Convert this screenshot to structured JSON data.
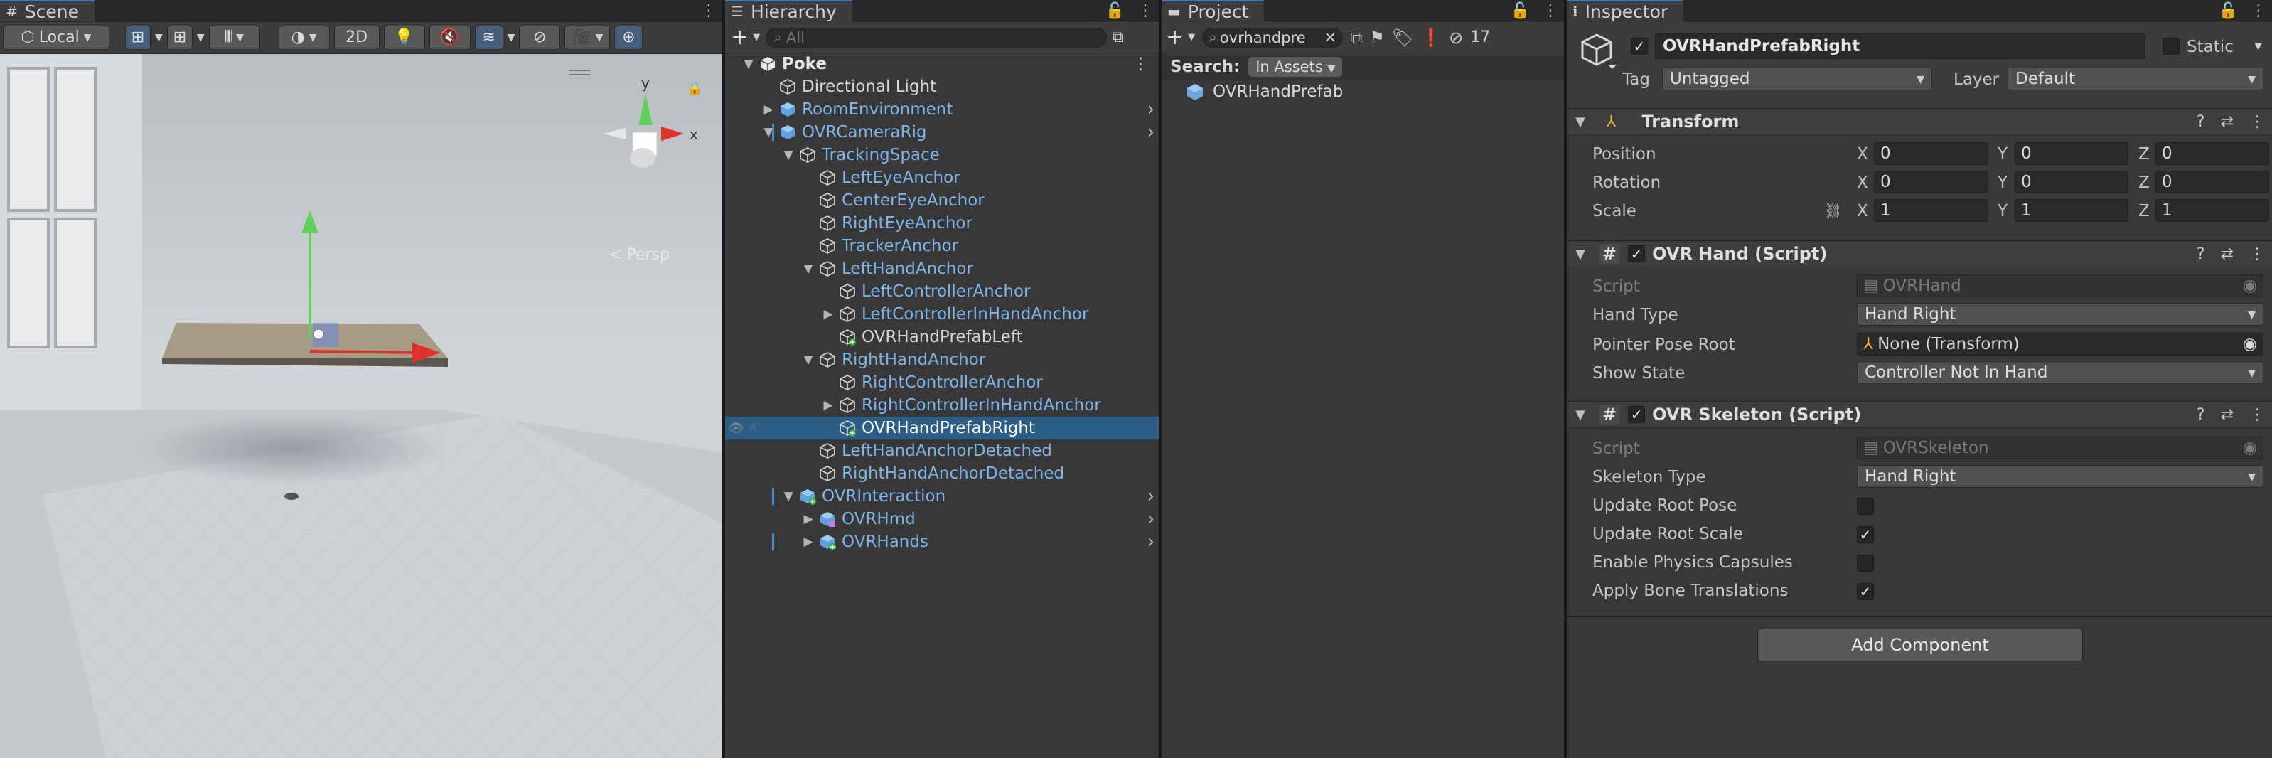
{
  "scene": {
    "tab": "Scene",
    "toolbar": {
      "pivot": "Local",
      "mode_2d": "2D"
    },
    "persp_label": "< Persp",
    "gizmo_axes": {
      "x": "x",
      "y": "y"
    }
  },
  "hierarchy": {
    "tab": "Hierarchy",
    "search_placeholder": "All",
    "items": [
      {
        "label": "Poke",
        "depth": 0,
        "expanded": true,
        "bold": true,
        "icon": "unity-scene-icon",
        "color": "white"
      },
      {
        "label": "Directional Light",
        "depth": 1,
        "icon": "gameobject-icon",
        "color": "white"
      },
      {
        "label": "RoomEnvironment",
        "depth": 1,
        "collapsed": true,
        "icon": "prefab-icon",
        "color": "blue",
        "chevron": true
      },
      {
        "label": "OVRCameraRig",
        "depth": 1,
        "expanded": true,
        "icon": "prefab-icon",
        "color": "blue",
        "chevron": true,
        "marked": true
      },
      {
        "label": "TrackingSpace",
        "depth": 2,
        "expanded": true,
        "icon": "gameobject-icon",
        "color": "blue"
      },
      {
        "label": "LeftEyeAnchor",
        "depth": 3,
        "icon": "gameobject-icon",
        "color": "blue"
      },
      {
        "label": "CenterEyeAnchor",
        "depth": 3,
        "icon": "gameobject-icon",
        "color": "blue"
      },
      {
        "label": "RightEyeAnchor",
        "depth": 3,
        "icon": "gameobject-icon",
        "color": "blue"
      },
      {
        "label": "TrackerAnchor",
        "depth": 3,
        "icon": "gameobject-icon",
        "color": "blue"
      },
      {
        "label": "LeftHandAnchor",
        "depth": 3,
        "expanded": true,
        "icon": "gameobject-icon",
        "color": "blue"
      },
      {
        "label": "LeftControllerAnchor",
        "depth": 4,
        "icon": "gameobject-icon",
        "color": "blue"
      },
      {
        "label": "LeftControllerInHandAnchor",
        "depth": 4,
        "collapsed": true,
        "icon": "gameobject-icon",
        "color": "blue"
      },
      {
        "label": "OVRHandPrefabLeft",
        "depth": 4,
        "icon": "gameobject-added-icon",
        "color": "white"
      },
      {
        "label": "RightHandAnchor",
        "depth": 3,
        "expanded": true,
        "icon": "gameobject-icon",
        "color": "blue"
      },
      {
        "label": "RightControllerAnchor",
        "depth": 4,
        "icon": "gameobject-icon",
        "color": "blue"
      },
      {
        "label": "RightControllerInHandAnchor",
        "depth": 4,
        "collapsed": true,
        "icon": "gameobject-icon",
        "color": "blue"
      },
      {
        "label": "OVRHandPrefabRight",
        "depth": 4,
        "icon": "gameobject-added-icon",
        "color": "white",
        "selected": true
      },
      {
        "label": "LeftHandAnchorDetached",
        "depth": 3,
        "icon": "gameobject-icon",
        "color": "blue"
      },
      {
        "label": "RightHandAnchorDetached",
        "depth": 3,
        "icon": "gameobject-icon",
        "color": "blue"
      },
      {
        "label": "OVRInteraction",
        "depth": 2,
        "expanded": true,
        "icon": "prefab-added-icon",
        "color": "blue",
        "chevron": true,
        "marked": true
      },
      {
        "label": "OVRHmd",
        "depth": 3,
        "collapsed": true,
        "icon": "prefab-variant-icon",
        "color": "blue",
        "chevron": true
      },
      {
        "label": "OVRHands",
        "depth": 3,
        "collapsed": true,
        "icon": "prefab-added-icon",
        "color": "blue",
        "chevron": true,
        "marked": true
      }
    ]
  },
  "project": {
    "tab": "Project",
    "search_value": "ovrhandpre",
    "hidden_count": "17",
    "search_label": "Search:",
    "scope": "In Assets",
    "results": [
      "OVRHandPrefab"
    ]
  },
  "inspector": {
    "tab": "Inspector",
    "object_name": "OVRHandPrefabRight",
    "static_label": "Static",
    "tag_label": "Tag",
    "tag_value": "Untagged",
    "layer_label": "Layer",
    "layer_value": "Default",
    "transform": {
      "title": "Transform",
      "rows": [
        {
          "label": "Position",
          "x": "0",
          "y": "0",
          "z": "0"
        },
        {
          "label": "Rotation",
          "x": "0",
          "y": "0",
          "z": "0"
        },
        {
          "label": "Scale",
          "x": "1",
          "y": "1",
          "z": "1"
        }
      ],
      "axis_labels": [
        "X",
        "Y",
        "Z"
      ]
    },
    "ovr_hand": {
      "title": "OVR Hand (Script)",
      "script_label": "Script",
      "script_value": "OVRHand",
      "hand_type_label": "Hand Type",
      "hand_type_value": "Hand Right",
      "pointer_label": "Pointer Pose Root",
      "pointer_value": "None (Transform)",
      "show_state_label": "Show State",
      "show_state_value": "Controller Not In Hand"
    },
    "ovr_skeleton": {
      "title": "OVR Skeleton (Script)",
      "script_label": "Script",
      "script_value": "OVRSkeleton",
      "skeleton_type_label": "Skeleton Type",
      "skeleton_type_value": "Hand Right",
      "toggles": [
        {
          "label": "Update Root Pose",
          "checked": false
        },
        {
          "label": "Update Root Scale",
          "checked": true
        },
        {
          "label": "Enable Physics Capsules",
          "checked": false
        },
        {
          "label": "Apply Bone Translations",
          "checked": true
        }
      ]
    },
    "add_component": "Add Component"
  },
  "colors": {
    "selection": "#2c5d87",
    "prefab_blue": "#7cb4ea",
    "panel_bg": "#383838",
    "gizmo_red": "#e0312b",
    "gizmo_green": "#5fd15a",
    "gizmo_blue": "#4a72d8"
  }
}
